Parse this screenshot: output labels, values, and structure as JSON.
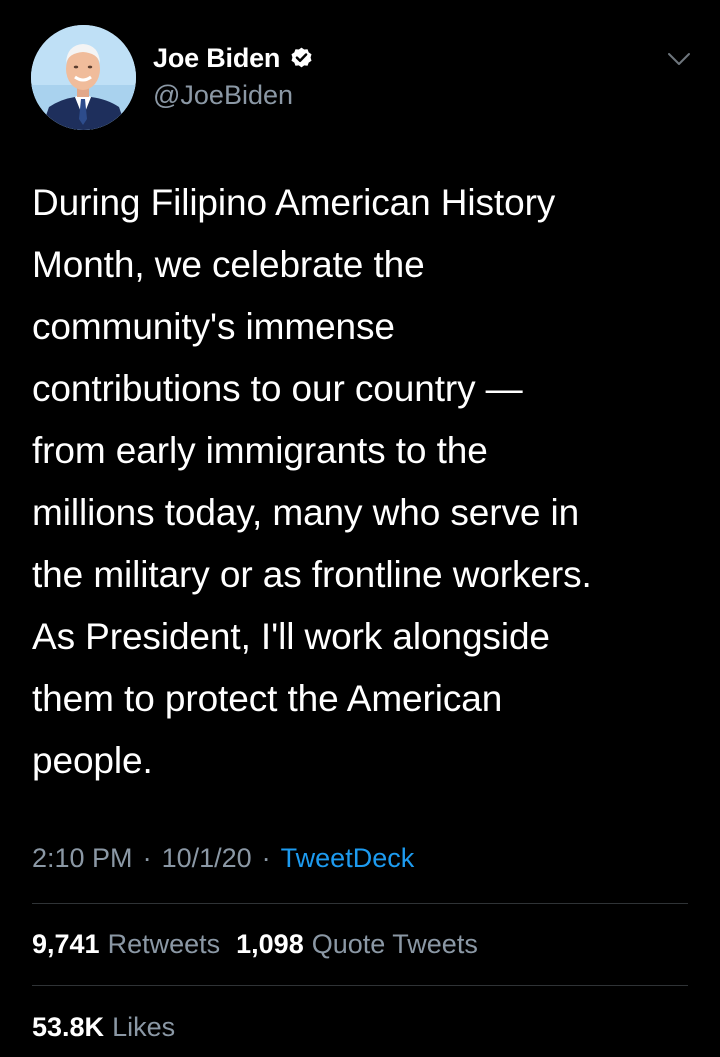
{
  "author": {
    "display_name": "Joe Biden",
    "handle": "@JoeBiden",
    "verified": true,
    "avatar_icon": "profile-photo-icon"
  },
  "tweet": {
    "text": "During Filipino American History\nMonth, we celebrate the\ncommunity's immense\ncontributions to our country —\nfrom early immigrants to the\nmillions today, many who serve in\nthe military or as frontline workers.\nAs President, I'll work alongside\nthem to protect the American\npeople."
  },
  "meta": {
    "time": "2:10 PM",
    "separator": "·",
    "date": "10/1/20",
    "source": "TweetDeck"
  },
  "stats": {
    "retweets_count": "9,741",
    "retweets_label": "Retweets",
    "quote_tweets_count": "1,098",
    "quote_tweets_label": "Quote Tweets",
    "likes_count": "53.8K",
    "likes_label": "Likes"
  },
  "colors": {
    "background": "#000000",
    "primary_text": "#ffffff",
    "secondary_text": "#8b98a5",
    "accent": "#1d9bf0",
    "divider": "#2f3336"
  }
}
